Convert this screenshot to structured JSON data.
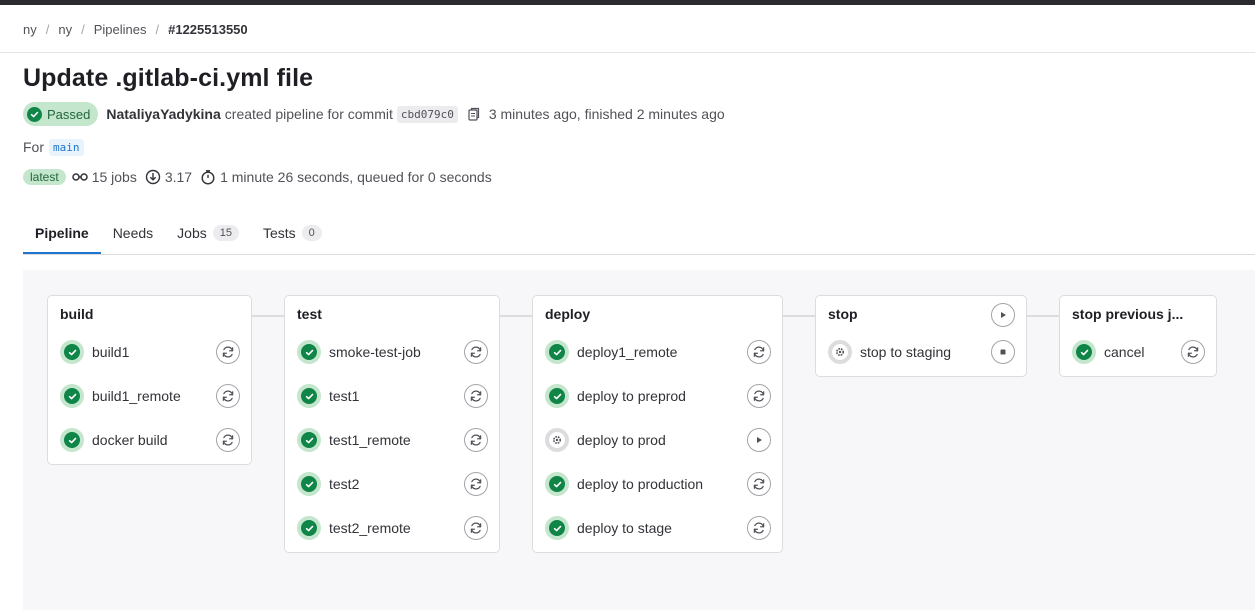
{
  "breadcrumb": {
    "items": [
      "ny",
      "ny",
      "Pipelines"
    ],
    "current": "#1225513550"
  },
  "title": "Update .gitlab-ci.yml file",
  "status": {
    "label": "Passed",
    "author": "NataliyaYadykina",
    "action_text": "created pipeline for commit",
    "commit_sha": "cbd079c0",
    "time_text": "3 minutes ago, finished 2 minutes ago"
  },
  "ref": {
    "for_label": "For",
    "branch": "main"
  },
  "summary": {
    "latest_badge": "latest",
    "jobs_text": "15 jobs",
    "score_text": "3.17",
    "duration_text": "1 minute 26 seconds, queued for 0 seconds"
  },
  "tabs": [
    {
      "label": "Pipeline",
      "count": null,
      "active": true
    },
    {
      "label": "Needs",
      "count": null,
      "active": false
    },
    {
      "label": "Jobs",
      "count": "15",
      "active": false
    },
    {
      "label": "Tests",
      "count": "0",
      "active": false
    }
  ],
  "stages": [
    {
      "name": "build",
      "jobs": [
        {
          "name": "build1",
          "status": "success",
          "action": "retry"
        },
        {
          "name": "build1_remote",
          "status": "success",
          "action": "retry"
        },
        {
          "name": "docker build",
          "status": "success",
          "action": "retry"
        }
      ]
    },
    {
      "name": "test",
      "jobs": [
        {
          "name": "smoke-test-job",
          "status": "success",
          "action": "retry"
        },
        {
          "name": "test1",
          "status": "success",
          "action": "retry"
        },
        {
          "name": "test1_remote",
          "status": "success",
          "action": "retry"
        },
        {
          "name": "test2",
          "status": "success",
          "action": "retry"
        },
        {
          "name": "test2_remote",
          "status": "success",
          "action": "retry"
        }
      ]
    },
    {
      "name": "deploy",
      "jobs": [
        {
          "name": "deploy1_remote",
          "status": "success",
          "action": "retry"
        },
        {
          "name": "deploy to preprod",
          "status": "success",
          "action": "retry"
        },
        {
          "name": "deploy to prod",
          "status": "manual",
          "action": "play"
        },
        {
          "name": "deploy to production",
          "status": "success",
          "action": "retry"
        },
        {
          "name": "deploy to stage",
          "status": "success",
          "action": "retry"
        }
      ]
    },
    {
      "name": "stop",
      "stage_action": "play",
      "jobs": [
        {
          "name": "stop to staging",
          "status": "manual",
          "action": "stop"
        }
      ]
    },
    {
      "name": "stop previous j...",
      "jobs": [
        {
          "name": "cancel",
          "status": "success",
          "action": "retry"
        }
      ]
    }
  ],
  "colors": {
    "success": "#108548",
    "success_bg": "#c3e6cd",
    "link": "#1f75cb",
    "canvas": "#f7f7f9"
  }
}
